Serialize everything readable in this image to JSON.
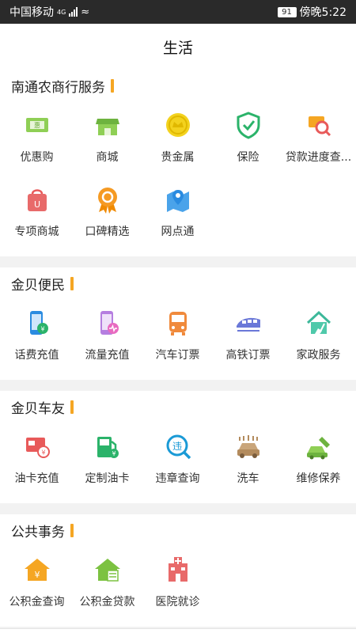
{
  "status_bar": {
    "carrier": "中国移动",
    "network": "4G",
    "battery": "91",
    "time": "傍晚5:22"
  },
  "header": {
    "title": "生活"
  },
  "sections": [
    {
      "title": "南通农商行服务",
      "items": [
        {
          "label": "优惠购",
          "icon": "coupon-icon"
        },
        {
          "label": "商城",
          "icon": "shop-icon"
        },
        {
          "label": "贵金属",
          "icon": "gold-coin-icon"
        },
        {
          "label": "保险",
          "icon": "shield-check-icon"
        },
        {
          "label": "贷款进度查...",
          "icon": "loan-search-icon"
        },
        {
          "label": "专项商城",
          "icon": "shopping-bag-icon"
        },
        {
          "label": "口碑精选",
          "icon": "badge-icon"
        },
        {
          "label": "网点通",
          "icon": "map-pin-icon"
        }
      ]
    },
    {
      "title": "金贝便民",
      "items": [
        {
          "label": "话费充值",
          "icon": "phone-recharge-icon"
        },
        {
          "label": "流量充值",
          "icon": "data-recharge-icon"
        },
        {
          "label": "汽车订票",
          "icon": "bus-icon"
        },
        {
          "label": "高铁订票",
          "icon": "train-icon"
        },
        {
          "label": "家政服务",
          "icon": "house-broom-icon"
        }
      ]
    },
    {
      "title": "金贝车友",
      "items": [
        {
          "label": "油卡充值",
          "icon": "fuel-card-icon"
        },
        {
          "label": "定制油卡",
          "icon": "fuel-pump-icon"
        },
        {
          "label": "违章查询",
          "icon": "violation-search-icon"
        },
        {
          "label": "洗车",
          "icon": "car-wash-icon"
        },
        {
          "label": "维修保养",
          "icon": "car-repair-icon"
        }
      ]
    },
    {
      "title": "公共事务",
      "items": [
        {
          "label": "公积金查询",
          "icon": "fund-house-icon"
        },
        {
          "label": "公积金贷款",
          "icon": "fund-loan-icon"
        },
        {
          "label": "医院就诊",
          "icon": "hospital-icon"
        }
      ]
    }
  ],
  "colors": {
    "accent": "#f5a623",
    "icon_green": "#7cc241",
    "icon_yellow": "#f3d21e",
    "icon_teal": "#2bb36a",
    "icon_orange": "#f59a23",
    "icon_red": "#e85a5a",
    "icon_blue": "#2a8be0",
    "icon_purple": "#b57ee0",
    "icon_indigo": "#6a78d8"
  }
}
